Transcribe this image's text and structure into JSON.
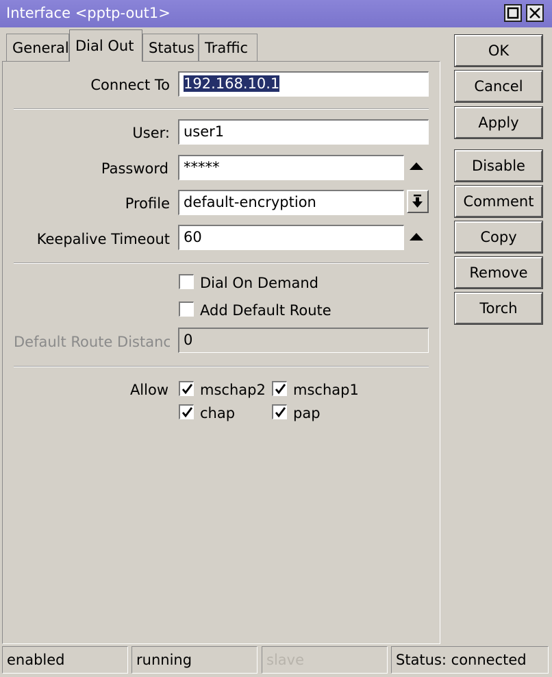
{
  "window": {
    "title": "Interface <pptp-out1>"
  },
  "tabs": [
    {
      "label": "General"
    },
    {
      "label": "Dial Out"
    },
    {
      "label": "Status"
    },
    {
      "label": "Traffic"
    }
  ],
  "form": {
    "connect_to": {
      "label": "Connect To",
      "value": "192.168.10.1"
    },
    "user": {
      "label": "User:",
      "value": "user1"
    },
    "password": {
      "label": "Password",
      "value": "*****"
    },
    "profile": {
      "label": "Profile",
      "value": "default-encryption"
    },
    "keepalive": {
      "label": "Keepalive Timeout",
      "value": "60"
    },
    "dial_on_demand": {
      "label": "Dial On Demand",
      "checked": false
    },
    "add_default_route": {
      "label": "Add Default Route",
      "checked": false
    },
    "default_route_distance": {
      "label": "Default Route Distance",
      "value": "0"
    },
    "allow": {
      "label": "Allow",
      "options": [
        {
          "label": "mschap2",
          "checked": true
        },
        {
          "label": "mschap1",
          "checked": true
        },
        {
          "label": "chap",
          "checked": true
        },
        {
          "label": "pap",
          "checked": true
        }
      ]
    }
  },
  "buttons": [
    "OK",
    "Cancel",
    "Apply",
    "Disable",
    "Comment",
    "Copy",
    "Remove",
    "Torch"
  ],
  "statusbar": {
    "enabled": "enabled",
    "running": "running",
    "slave": "slave",
    "status": "Status: connected"
  },
  "colors": {
    "titlebar": "#7a74cc",
    "window_bg": "#d4d0c8",
    "selection": "#24306a"
  },
  "icons": [
    "maximize-icon",
    "close-icon",
    "up-arrow-icon",
    "dropdown-icon",
    "checkmark-icon"
  ]
}
